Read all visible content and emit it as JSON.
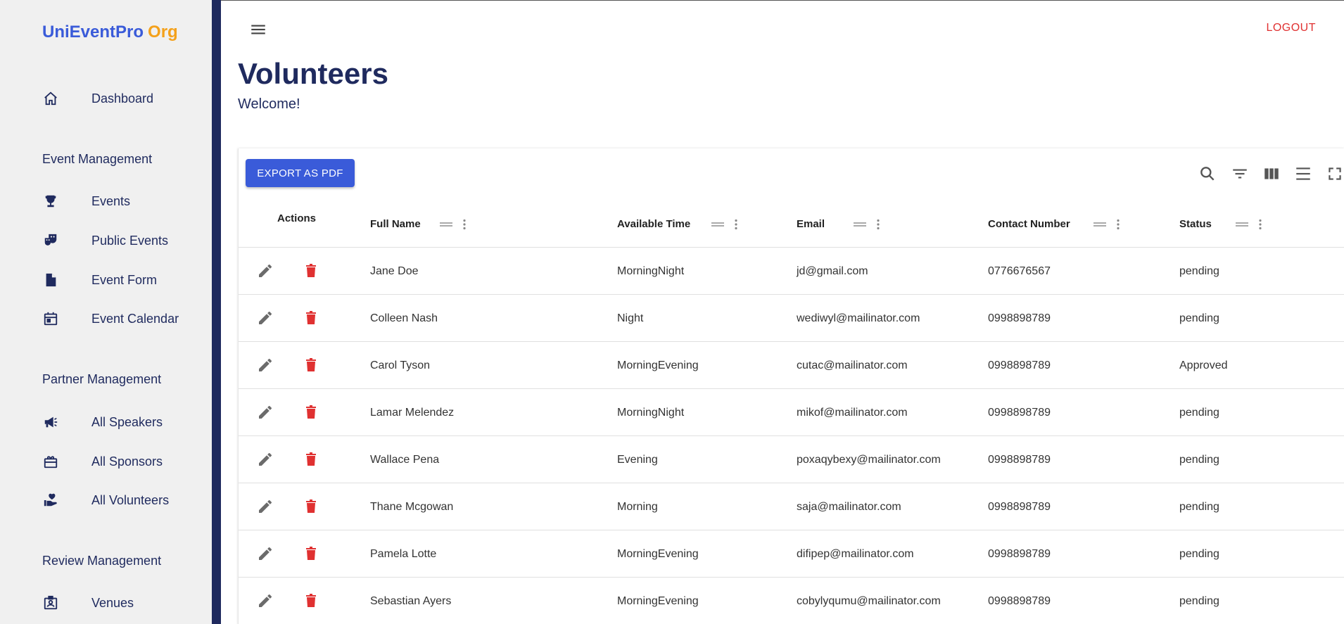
{
  "brand": {
    "part1": "UniEventPro",
    "part2": "Org"
  },
  "sidebar": {
    "items": [
      {
        "label": "Dashboard",
        "icon": "home-icon"
      }
    ],
    "sections": [
      {
        "title": "Event Management",
        "items": [
          {
            "label": "Events",
            "icon": "trophy-icon"
          },
          {
            "label": "Public Events",
            "icon": "theater-masks-icon"
          },
          {
            "label": "Event Form",
            "icon": "document-icon"
          },
          {
            "label": "Event Calendar",
            "icon": "calendar-icon"
          }
        ]
      },
      {
        "title": "Partner Management",
        "items": [
          {
            "label": "All Speakers",
            "icon": "megaphone-icon"
          },
          {
            "label": "All Sponsors",
            "icon": "gift-icon"
          },
          {
            "label": "All Volunteers",
            "icon": "hand-heart-icon"
          }
        ]
      },
      {
        "title": "Review Management",
        "items": [
          {
            "label": "Venues",
            "icon": "badge-icon"
          }
        ]
      }
    ]
  },
  "header": {
    "logout": "LOGOUT"
  },
  "page": {
    "title": "Volunteers",
    "subtitle": "Welcome!"
  },
  "table": {
    "export_label": "EXPORT AS PDF",
    "columns": [
      "Actions",
      "Full Name",
      "Available Time",
      "Email",
      "Contact Number",
      "Status"
    ],
    "rows": [
      {
        "name": "Jane Doe",
        "time": "MorningNight",
        "email": "jd@gmail.com",
        "contact": "0776676567",
        "status": "pending"
      },
      {
        "name": "Colleen Nash",
        "time": "Night",
        "email": "wediwyl@mailinator.com",
        "contact": "0998898789",
        "status": "pending"
      },
      {
        "name": "Carol Tyson",
        "time": "MorningEvening",
        "email": "cutac@mailinator.com",
        "contact": "0998898789",
        "status": "Approved"
      },
      {
        "name": "Lamar Melendez",
        "time": "MorningNight",
        "email": "mikof@mailinator.com",
        "contact": "0998898789",
        "status": "pending"
      },
      {
        "name": "Wallace Pena",
        "time": "Evening",
        "email": "poxaqybexy@mailinator.com",
        "contact": "0998898789",
        "status": "pending"
      },
      {
        "name": "Thane Mcgowan",
        "time": "Morning",
        "email": "saja@mailinator.com",
        "contact": "0998898789",
        "status": "pending"
      },
      {
        "name": "Pamela Lotte",
        "time": "MorningEvening",
        "email": "difipep@mailinator.com",
        "contact": "0998898789",
        "status": "pending"
      },
      {
        "name": "Sebastian Ayers",
        "time": "MorningEvening",
        "email": "cobylyqumu@mailinator.com",
        "contact": "0998898789",
        "status": "pending"
      }
    ]
  },
  "colors": {
    "brand_primary": "#3a5bd9",
    "brand_accent": "#f4a11b",
    "navy": "#1f2a5e",
    "danger": "#e03131",
    "edit_icon": "#6b6b6b"
  }
}
